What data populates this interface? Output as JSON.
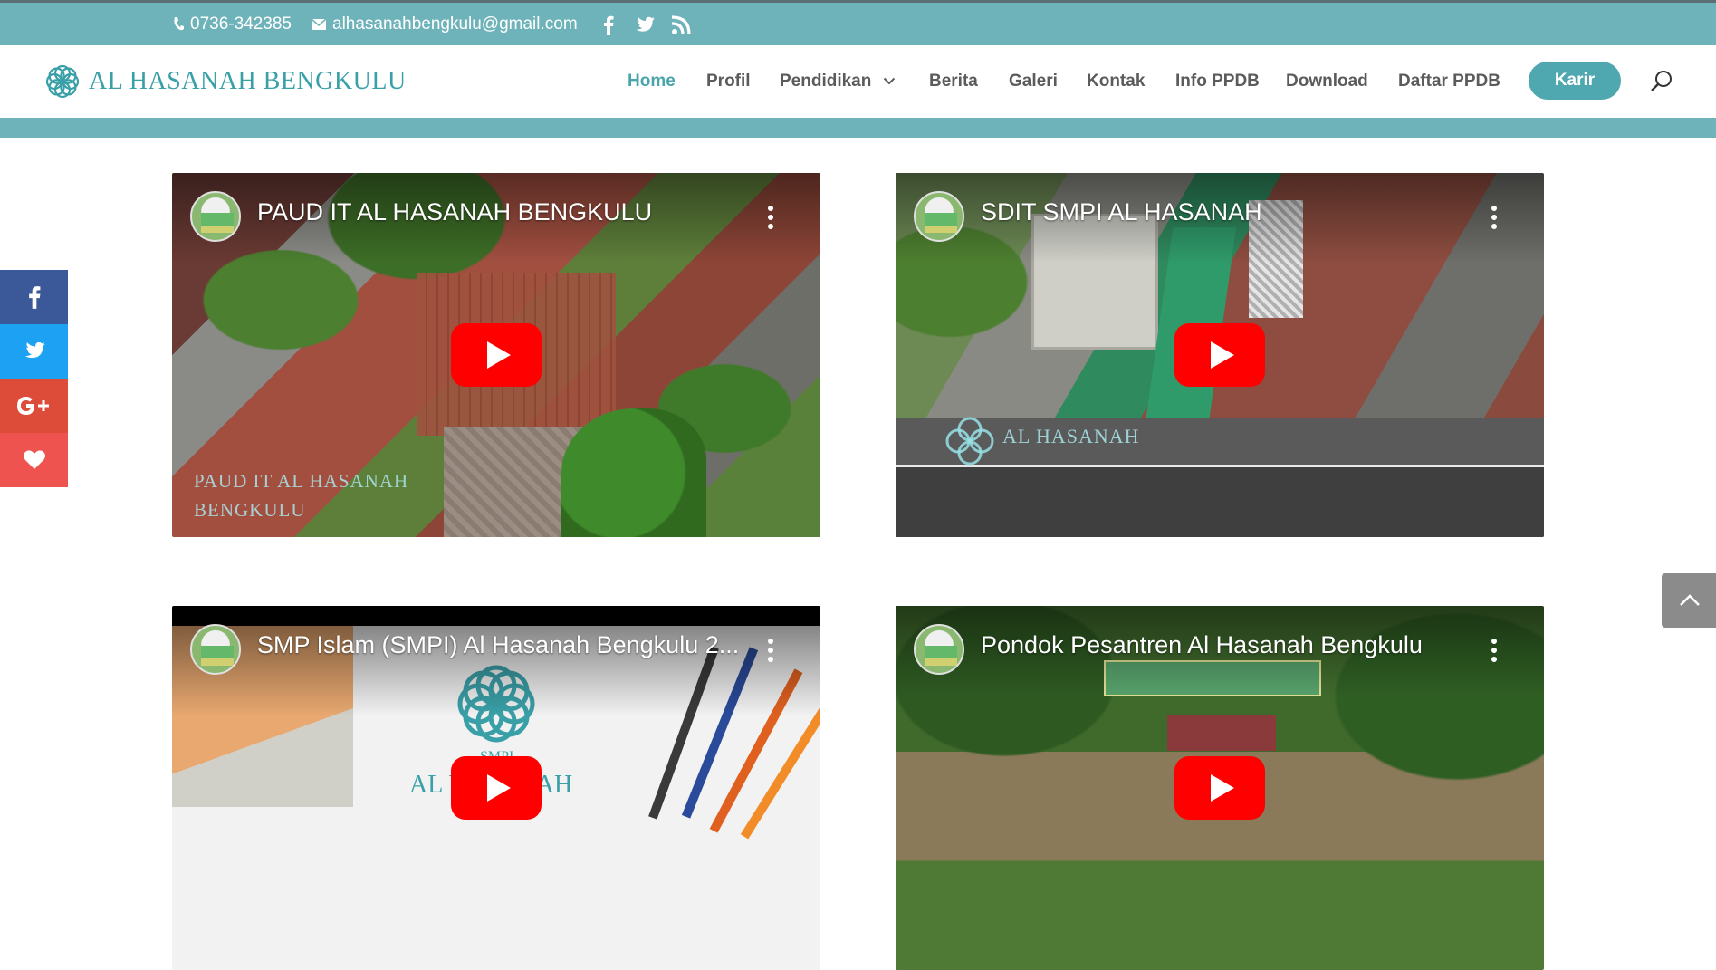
{
  "topbar": {
    "phone": "0736-342385",
    "email": "alhasanahbengkulu@gmail.com",
    "social_icons": [
      "facebook-icon",
      "twitter-icon",
      "rss-icon"
    ]
  },
  "header": {
    "logo_text": "AL HASANAH BENGKULU",
    "nav": {
      "home": "Home",
      "profil": "Profil",
      "pendidikan": "Pendidikan",
      "berita": "Berita",
      "galeri": "Galeri",
      "kontak": "Kontak",
      "info_ppdb": "Info PPDB",
      "download": "Download",
      "daftar_ppdb": "Daftar PPDB"
    },
    "karir_label": "Karir"
  },
  "videos": [
    {
      "title": "PAUD IT AL HASANAH BENGKULU",
      "watermark_line1": "PAUD IT AL HASANAH",
      "watermark_line2": "BENGKULU"
    },
    {
      "title": "SDIT SMPI AL HASANAH",
      "watermark": "AL HASANAH"
    },
    {
      "title": "SMP Islam (SMPI) Al Hasanah Bengkulu 2...",
      "watermark_small": "SMPI",
      "watermark_big": "AL HASANAH"
    },
    {
      "title": "Pondok Pesantren Al Hasanah Bengkulu"
    }
  ],
  "side_share": [
    "facebook-icon",
    "twitter-icon",
    "google-plus-icon",
    "heart-icon"
  ],
  "colors": {
    "teal": "#6fb3ba",
    "accent": "#4fa8b0",
    "facebook": "#3b5998",
    "twitter": "#1da1f2",
    "google_plus": "#dd4b39",
    "heart": "#ef5350",
    "youtube_red": "#ff0000"
  }
}
